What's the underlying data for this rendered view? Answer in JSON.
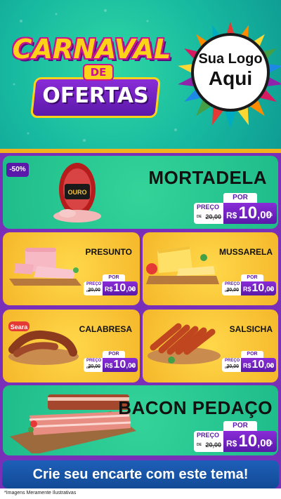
{
  "header": {
    "title_line1": "CARNAVAL",
    "title_connector": "DE",
    "title_line2": "OFERTAS",
    "logo_line1": "Sua Logo",
    "logo_line2": "Aqui"
  },
  "featured": {
    "badge": "-50%",
    "brand": "OURO",
    "name": "MORTADELA",
    "price": {
      "por_label": "POR",
      "preco_label": "PREÇO",
      "de_label": "DE",
      "old": "20,00",
      "currency": "R$",
      "int": "10",
      "cents": ",00",
      "unit": "KG"
    }
  },
  "products": [
    {
      "name": "PRESUNTO",
      "price": {
        "por_label": "POR",
        "preco_label": "PREÇO",
        "de_label": "DE",
        "old": "20,00",
        "currency": "R$",
        "int": "10",
        "cents": ",00",
        "unit": "KG"
      }
    },
    {
      "name": "MUSSARELA",
      "price": {
        "por_label": "POR",
        "preco_label": "PREÇO",
        "de_label": "DE",
        "old": "20,00",
        "currency": "R$",
        "int": "10",
        "cents": ",00",
        "unit": "KG"
      }
    },
    {
      "name": "CALABRESA",
      "brand": "Seara",
      "price": {
        "por_label": "POR",
        "preco_label": "PREÇO",
        "de_label": "DE",
        "old": "20,00",
        "currency": "R$",
        "int": "10",
        "cents": ",00",
        "unit": "KG"
      }
    },
    {
      "name": "SALSICHA",
      "price": {
        "por_label": "POR",
        "preco_label": "PREÇO",
        "de_label": "DE",
        "old": "20,00",
        "currency": "R$",
        "int": "10",
        "cents": ",00",
        "unit": "KG"
      }
    }
  ],
  "bacon": {
    "name": "BACON PEDAÇO",
    "price": {
      "por_label": "POR",
      "preco_label": "PREÇO",
      "de_label": "DE",
      "old": "20,00",
      "currency": "R$",
      "int": "10",
      "cents": ",00",
      "unit": "KG"
    }
  },
  "footer": {
    "cta": "Crie seu encarte com este tema!",
    "disclaimer": "*Imagens Meramente Ilustrativas"
  },
  "colors": {
    "background_purple": "#7a2fb8",
    "green_panel": "#1fbc8a",
    "yellow_panel": "#f5b72a",
    "price_purple": "#5a19a8",
    "cta_blue": "#1d5fb8",
    "title_yellow": "#ffd21a",
    "title_pink": "#c8158f"
  }
}
